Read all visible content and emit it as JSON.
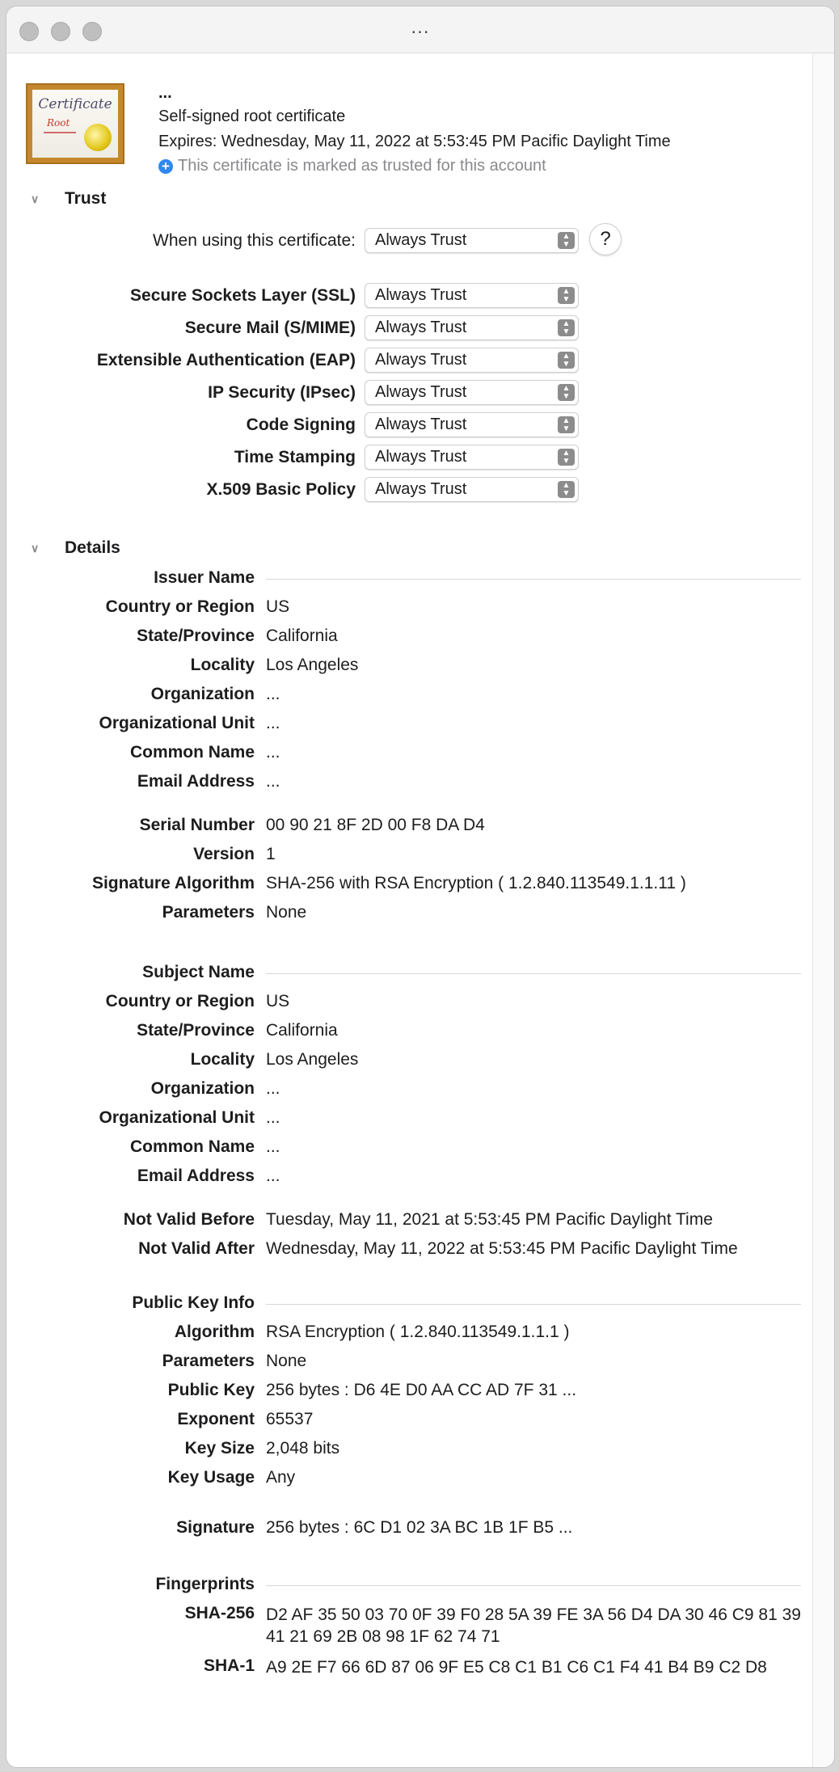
{
  "window": {
    "title": "..."
  },
  "header": {
    "name": "...",
    "subtitle": "Self-signed root certificate",
    "expires": "Expires: Wednesday, May 11, 2022 at 5:53:45 PM Pacific Daylight Time",
    "trusted_note": "This certificate is marked as trusted for this account",
    "icon_word": "Certificate",
    "icon_sub": "Root"
  },
  "trust": {
    "section_label": "Trust",
    "when_using_label": "When using this certificate:",
    "when_using_value": "Always Trust",
    "help_label": "?",
    "policies": [
      {
        "label": "Secure Sockets Layer (SSL)",
        "value": "Always Trust"
      },
      {
        "label": "Secure Mail (S/MIME)",
        "value": "Always Trust"
      },
      {
        "label": "Extensible Authentication (EAP)",
        "value": "Always Trust"
      },
      {
        "label": "IP Security (IPsec)",
        "value": "Always Trust"
      },
      {
        "label": "Code Signing",
        "value": "Always Trust"
      },
      {
        "label": "Time Stamping",
        "value": "Always Trust"
      },
      {
        "label": "X.509 Basic Policy",
        "value": "Always Trust"
      }
    ]
  },
  "details": {
    "section_label": "Details",
    "issuer": {
      "heading": "Issuer Name",
      "rows": [
        {
          "label": "Country or Region",
          "value": "US"
        },
        {
          "label": "State/Province",
          "value": "California"
        },
        {
          "label": "Locality",
          "value": "Los Angeles"
        },
        {
          "label": "Organization",
          "value": "..."
        },
        {
          "label": "Organizational Unit",
          "value": "..."
        },
        {
          "label": "Common Name",
          "value": "..."
        },
        {
          "label": "Email Address",
          "value": "..."
        }
      ]
    },
    "info": [
      {
        "label": "Serial Number",
        "value": "00 90 21 8F 2D 00 F8 DA D4"
      },
      {
        "label": "Version",
        "value": "1"
      },
      {
        "label": "Signature Algorithm",
        "value": "SHA-256 with RSA Encryption ( 1.2.840.113549.1.1.11 )"
      },
      {
        "label": "Parameters",
        "value": "None"
      }
    ],
    "subject": {
      "heading": "Subject Name",
      "rows": [
        {
          "label": "Country or Region",
          "value": "US"
        },
        {
          "label": "State/Province",
          "value": "California"
        },
        {
          "label": "Locality",
          "value": "Los Angeles"
        },
        {
          "label": "Organization",
          "value": "..."
        },
        {
          "label": "Organizational Unit",
          "value": "..."
        },
        {
          "label": "Common Name",
          "value": "..."
        },
        {
          "label": "Email Address",
          "value": "..."
        }
      ]
    },
    "validity": [
      {
        "label": "Not Valid Before",
        "value": "Tuesday, May 11, 2021 at 5:53:45 PM Pacific Daylight Time"
      },
      {
        "label": "Not Valid After",
        "value": "Wednesday, May 11, 2022 at 5:53:45 PM Pacific Daylight Time"
      }
    ],
    "public_key": {
      "heading": "Public Key Info",
      "rows": [
        {
          "label": "Algorithm",
          "value": "RSA Encryption ( 1.2.840.113549.1.1.1 )"
        },
        {
          "label": "Parameters",
          "value": "None"
        },
        {
          "label": "Public Key",
          "value": "256 bytes : D6 4E D0 AA CC AD 7F 31 ..."
        },
        {
          "label": "Exponent",
          "value": "65537"
        },
        {
          "label": "Key Size",
          "value": "2,048 bits"
        },
        {
          "label": "Key Usage",
          "value": "Any"
        }
      ]
    },
    "signature": {
      "label": "Signature",
      "value": "256 bytes : 6C D1 02 3A BC 1B 1F B5 ..."
    },
    "fingerprints": {
      "heading": "Fingerprints",
      "rows": [
        {
          "label": "SHA-256",
          "value": "D2 AF 35 50 03 70 0F 39 F0 28 5A 39 FE 3A 56 D4 DA 30 46 C9 81 39 41 21 69 2B 08 98 1F 62 74 71"
        },
        {
          "label": "SHA-1",
          "value": "A9 2E F7 66 6D 87 06 9F E5 C8 C1 B1 C6 C1 F4 41 B4 B9 C2 D8"
        }
      ]
    }
  }
}
